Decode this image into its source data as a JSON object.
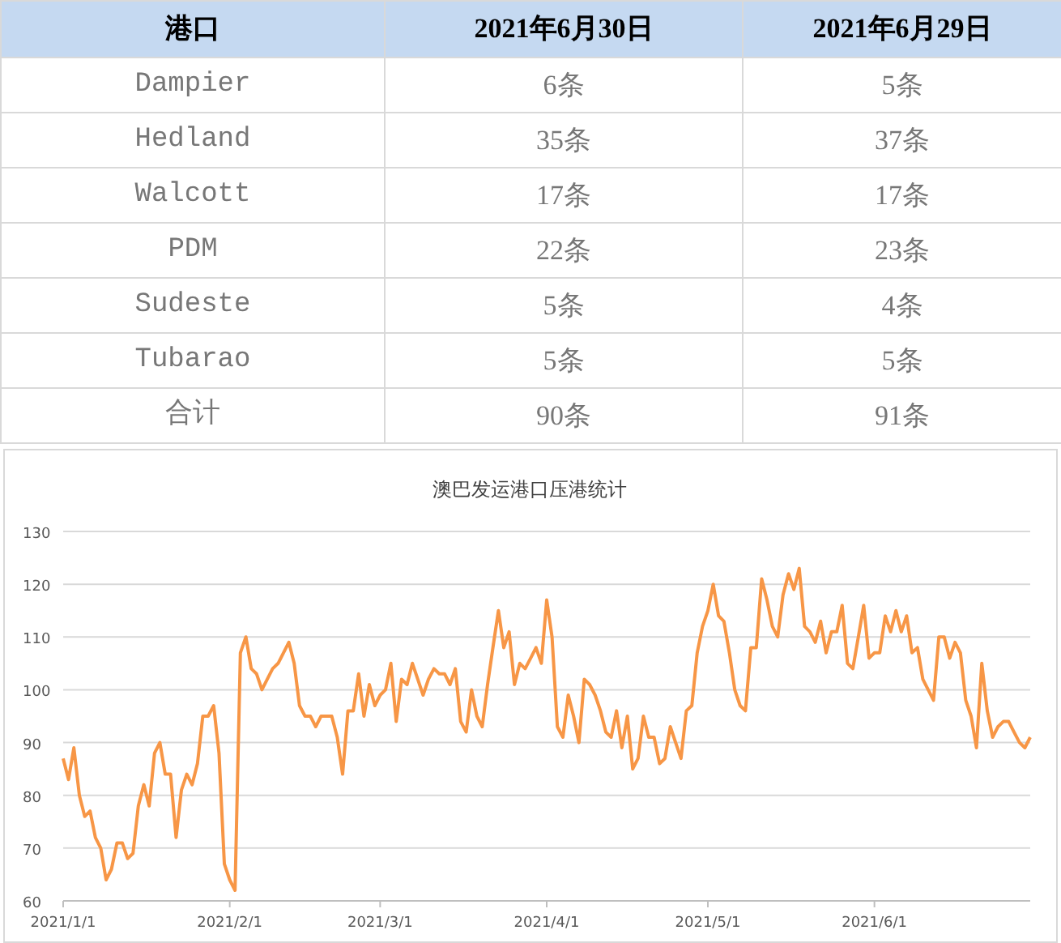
{
  "table": {
    "columns": [
      "港口",
      "2021年6月30日",
      "2021年6月29日"
    ],
    "rows": [
      [
        "Dampier",
        "6条",
        "5条"
      ],
      [
        "Hedland",
        "35条",
        "37条"
      ],
      [
        "Walcott",
        "17条",
        "17条"
      ],
      [
        "PDM",
        "22条",
        "23条"
      ],
      [
        "Sudeste",
        "5条",
        "4条"
      ],
      [
        "Tubarao",
        "5条",
        "5条"
      ],
      [
        "合计",
        "90条",
        "91条"
      ]
    ]
  },
  "chart": {
    "chart_data": {
      "type": "line",
      "title": "澳巴发运港口压港统计",
      "categories": [
        "2021/1/1",
        null,
        null,
        null,
        null,
        null,
        null,
        null,
        null,
        null,
        null,
        null,
        null,
        null,
        null,
        null,
        null,
        null,
        null,
        null,
        null,
        null,
        null,
        null,
        null,
        null,
        null,
        null,
        null,
        null,
        null,
        "2021/2/1",
        null,
        null,
        null,
        null,
        null,
        null,
        null,
        null,
        null,
        null,
        null,
        null,
        null,
        null,
        null,
        null,
        null,
        null,
        null,
        null,
        null,
        null,
        null,
        null,
        null,
        null,
        null,
        "2021/3/1",
        null,
        null,
        null,
        null,
        null,
        null,
        null,
        null,
        null,
        null,
        null,
        null,
        null,
        null,
        null,
        null,
        null,
        null,
        null,
        null,
        null,
        null,
        null,
        null,
        null,
        null,
        null,
        null,
        null,
        null,
        "2021/4/1",
        null,
        null,
        null,
        null,
        null,
        null,
        null,
        null,
        null,
        null,
        null,
        null,
        null,
        null,
        null,
        null,
        null,
        null,
        null,
        null,
        null,
        null,
        null,
        null,
        null,
        null,
        null,
        null,
        null,
        "2021/5/1",
        null,
        null,
        null,
        null,
        null,
        null,
        null,
        null,
        null,
        null,
        null,
        null,
        null,
        null,
        null,
        null,
        null,
        null,
        null,
        null,
        null,
        null,
        null,
        null,
        null,
        null,
        null,
        null,
        null,
        null,
        "2021/6/1",
        null,
        null,
        null,
        null,
        null,
        null,
        null,
        null,
        null,
        null,
        null,
        null,
        null,
        null,
        null,
        null,
        null,
        null,
        null,
        null,
        null,
        null,
        null,
        null,
        null,
        null,
        null,
        null,
        null
      ],
      "series": [
        {
          "color": "#f79646",
          "values": [
            87,
            83,
            89,
            80,
            76,
            77,
            72,
            70,
            64,
            66,
            71,
            71,
            68,
            69,
            78,
            82,
            78,
            88,
            90,
            84,
            84,
            72,
            81,
            84,
            82,
            86,
            95,
            95,
            97,
            88,
            67,
            64,
            62,
            107,
            110,
            104,
            103,
            100,
            102,
            104,
            105,
            107,
            109,
            105,
            97,
            95,
            95,
            93,
            95,
            95,
            95,
            91,
            84,
            96,
            96,
            103,
            95,
            101,
            97,
            99,
            100,
            105,
            94,
            102,
            101,
            105,
            102,
            99,
            102,
            104,
            103,
            103,
            101,
            104,
            94,
            92,
            100,
            95,
            93,
            101,
            108,
            115,
            108,
            111,
            101,
            105,
            104,
            106,
            108,
            105,
            117,
            110,
            93,
            91,
            99,
            95,
            90,
            102,
            101,
            99,
            96,
            92,
            91,
            96,
            89,
            95,
            85,
            87,
            95,
            91,
            91,
            86,
            87,
            93,
            90,
            87,
            96,
            97,
            107,
            112,
            115,
            120,
            114,
            113,
            107,
            100,
            97,
            96,
            108,
            108,
            121,
            117,
            112,
            110,
            118,
            122,
            119,
            123,
            112,
            111,
            109,
            113,
            107,
            111,
            111,
            116,
            105,
            104,
            110,
            116,
            106,
            107,
            107,
            114,
            111,
            115,
            111,
            114,
            107,
            108,
            102,
            100,
            98,
            110,
            110,
            106,
            109,
            107,
            98,
            95,
            89,
            105,
            96,
            91,
            93,
            94,
            94,
            92,
            90,
            89,
            91
          ]
        }
      ],
      "ylim": [
        60,
        130
      ],
      "grid": true,
      "yticks": [
        60,
        70,
        80,
        90,
        100,
        110,
        120,
        130
      ]
    }
  }
}
